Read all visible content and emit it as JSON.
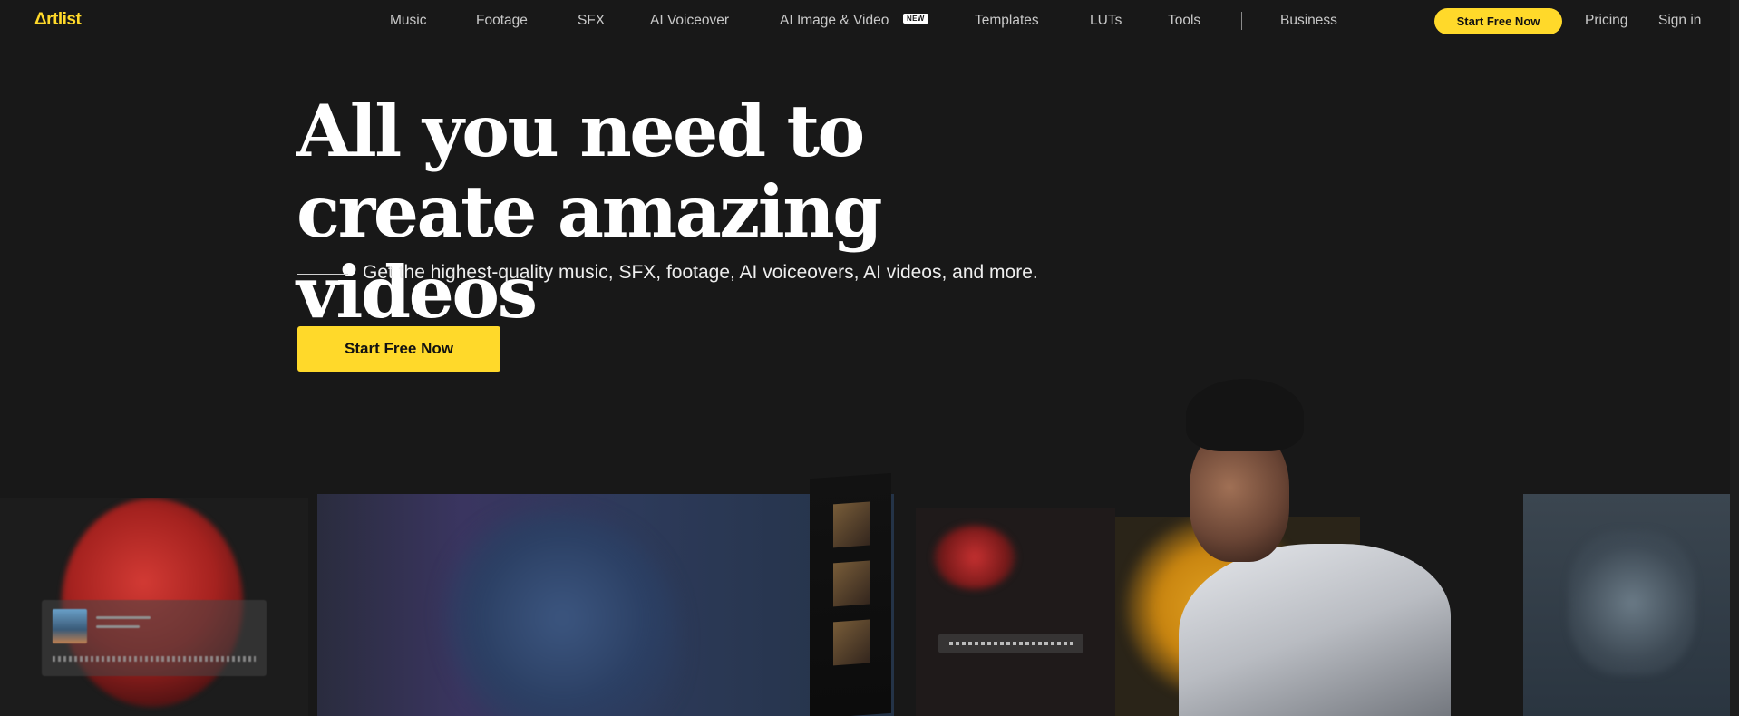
{
  "brand": {
    "logo_text": "Δrtlist",
    "accent_color": "#ffd92a"
  },
  "nav": {
    "items": [
      {
        "label": "Music"
      },
      {
        "label": "Footage"
      },
      {
        "label": "SFX"
      },
      {
        "label": "AI Voiceover"
      },
      {
        "label": "AI Image & Video"
      },
      {
        "label": "Templates"
      },
      {
        "label": "LUTs"
      },
      {
        "label": "Tools"
      },
      {
        "label": "Business"
      }
    ],
    "new_badge": "NEW",
    "cta_label": "Start Free Now",
    "pricing_label": "Pricing",
    "signin_label": "Sign in"
  },
  "hero": {
    "headline": "All you need to create amazing videos",
    "subtitle": "Get the highest-quality music, SFX, footage, AI voiceovers, AI videos, and more.",
    "cta_label": "Start Free Now"
  }
}
